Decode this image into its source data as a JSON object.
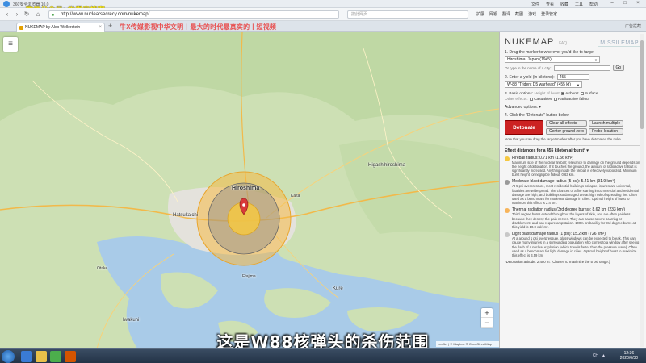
{
  "overlay_text": "微信公众号: 世界史档案",
  "browser": {
    "app_title": "360安全浏览器 10.0",
    "menu": [
      "文件",
      "查看",
      "收藏",
      "工具",
      "帮助"
    ],
    "url": "http://www.nuclearsecrecy.com/nukemap/",
    "search_placeholder": "搜此网页",
    "extensions": [
      "扩展",
      "网银",
      "翻译",
      "截图",
      "游戏",
      "登录管家"
    ],
    "tab_title": "NUKEMAP by Alex Wellerstein",
    "promo_text": "牛X传媒影视中华文明丨最大的时代最真实的丨短视频",
    "tab_right": [
      "广告拦截"
    ],
    "colors": {
      "promo": "#e85050",
      "overlay": "#f0e020"
    }
  },
  "map": {
    "labels": {
      "hiroshima": "Hiroshima",
      "higashihiroshima": "Higashihiroshima",
      "hatsukaichi": "Hatsukaichi",
      "kaita": "Kaita",
      "kure": "Kure",
      "iwakuni": "Iwakuni",
      "otake": "Otake",
      "etajima": "Etajima"
    },
    "zoom_in": "+",
    "zoom_out": "−",
    "attribution": "Leaflet | © Mapbox © OpenStreetMap"
  },
  "panel": {
    "brand": "NUKEMAP",
    "faq": "FAQ",
    "missilemap": "MISSILEMAP",
    "step1_label": "1. Drag the marker to wherever you'd like to target",
    "target_city": "Hiroshima, Japan (1945)",
    "city_prompt": "Or type in the name of a city:",
    "go_label": "Go",
    "step2_label": "2. Enter a yield (in kilotons):",
    "yield_value": "455",
    "warhead": "W-88 \"Trident D5 warhead\" (455 kt)",
    "step3_label": "3. Basic options:",
    "height_label": "Height of burst",
    "airburst": "Airburst",
    "surface": "Surface",
    "other_effects": "Other effects:",
    "casualties": "Casualties",
    "fallout": "Radioactive fallout",
    "advanced": "Advanced options: ▾",
    "step4_label": "4. Click the \"Detonate\" button below",
    "detonate": "Detonate",
    "buttons": [
      "Clear all effects",
      "Launch multiple",
      "Center ground zero",
      "Probe location"
    ],
    "note": "Note that you can drag the target marker after you have detonated the nuke.",
    "effects_head": "Effect distances for a 455 kiloton airburst* ▾",
    "effects": [
      {
        "title": "Fireball radius: 0.71 km (1.56 km²)",
        "desc": "Maximum size of the nuclear fireball; relevance to damage on the ground depends on the height of detonation. If it touches the ground, the amount of radioactive fallout is significantly increased. Anything inside the fireball is effectively vaporized. Minimum burst height for negligible fallout: 0.63 km.",
        "color": "#f5c842"
      },
      {
        "title": "Moderate blast damage radius (5 psi): 5.41 km (91.9 km²)",
        "desc": "At 5 psi overpressure, most residential buildings collapse, injuries are universal, fatalities are widespread. The chances of a fire starting in commercial and residential damage are high, and buildings so damaged are at high risk of spreading fire. Often used as a benchmark for moderate damage in cities. Optimal height of burst to maximize this effect is 2.4 km.",
        "color": "#9a9a9a"
      },
      {
        "title": "Thermal radiation radius (3rd degree burns): 8.62 km (233 km²)",
        "desc": "Third degree burns extend throughout the layers of skin, and are often painless because they destroy the pain nerves. They can cause severe scarring or disablement, and can require amputation. 100% probability for 3rd degree burns at this yield is 10.8 cal/cm².",
        "color": "#f7b45a"
      },
      {
        "title": "Light blast damage radius (1 psi): 15.2 km (726 km²)",
        "desc": "At a around 1 psi overpressure, glass windows can be expected to break. This can cause many injuries in a surrounding population who comes to a window after seeing the flash of a nuclear explosion (which travels faster than the pressure wave). Often used as a benchmark for light damage in cities. Optimal height of burst to maximize this effect is 3.59 km.",
        "color": "#c8c8c8"
      }
    ],
    "footnote": "*Detonation altitude: 2,400 m. (Chosen to maximize the 5 psi range.)"
  },
  "subtitle": "这是W88核弹头的杀伤范围",
  "taskbar": {
    "time": "12:36",
    "date": "2020/6/30",
    "tray": [
      "CH",
      "▲"
    ]
  }
}
